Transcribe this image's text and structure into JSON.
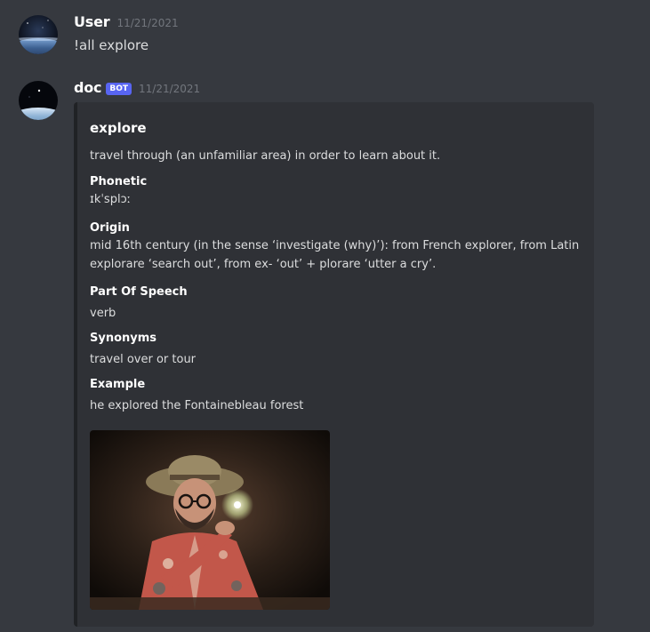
{
  "messages": {
    "user": {
      "username": "User",
      "timestamp": "11/21/2021",
      "text": "!all explore"
    },
    "doc": {
      "username": "doc",
      "bot_tag": "BOT",
      "timestamp": "11/21/2021",
      "embed": {
        "title": "explore",
        "description": "travel through (an unfamiliar area) in order to learn about it.",
        "fields": [
          {
            "name": "Phonetic",
            "value": "ɪkˈsplɔː"
          },
          {
            "name": "Origin",
            "value": "mid 16th century (in the sense ‘investigate (why)’): from French explorer, from Latin explorare ‘search out’, from ex- ‘out’ + plorare ‘utter a cry’."
          },
          {
            "name": "Part Of Speech",
            "value": "verb"
          },
          {
            "name": "Synonyms",
            "value": "travel over or tour"
          },
          {
            "name": "Example",
            "value": "he explored the Fontainebleau forest"
          }
        ]
      }
    }
  },
  "colors": {
    "background": "#36393f",
    "embed_background": "#2f3136",
    "embed_border": "#202225",
    "bot_tag": "#5865f2",
    "timestamp": "#72767d",
    "text": "#dcddde"
  },
  "icons": {
    "user_avatar": "space-earth-avatar-icon",
    "doc_avatar": "planet-horizon-avatar-icon",
    "embed_image": "explorer-gif-image"
  }
}
